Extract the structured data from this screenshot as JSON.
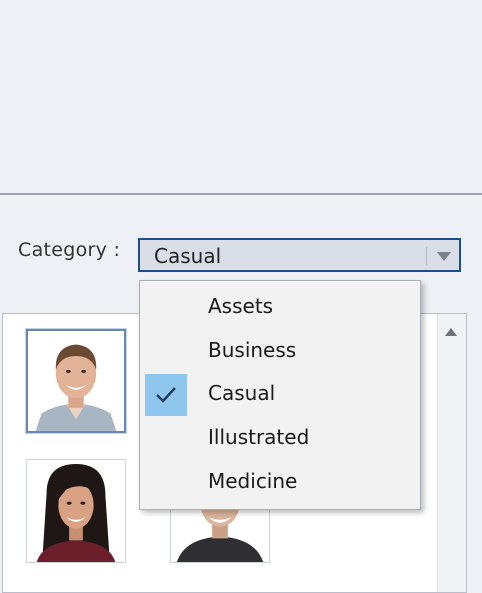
{
  "category": {
    "label": "Category :",
    "selected": "Casual",
    "options": [
      {
        "label": "Assets",
        "checked": false
      },
      {
        "label": "Business",
        "checked": false
      },
      {
        "label": "Casual",
        "checked": true
      },
      {
        "label": "Illustrated",
        "checked": false
      },
      {
        "label": "Medicine",
        "checked": false
      }
    ]
  },
  "gallery": {
    "thumbnails": [
      {
        "name": "avatar-man-gray-shirt",
        "selected": true
      },
      {
        "name": "avatar-woman-black-hair",
        "selected": false
      },
      {
        "name": "avatar-man-dark-shirt",
        "selected": false
      }
    ]
  },
  "colors": {
    "accent_border": "#1f4e8c",
    "check_highlight": "#8fc6ee"
  }
}
